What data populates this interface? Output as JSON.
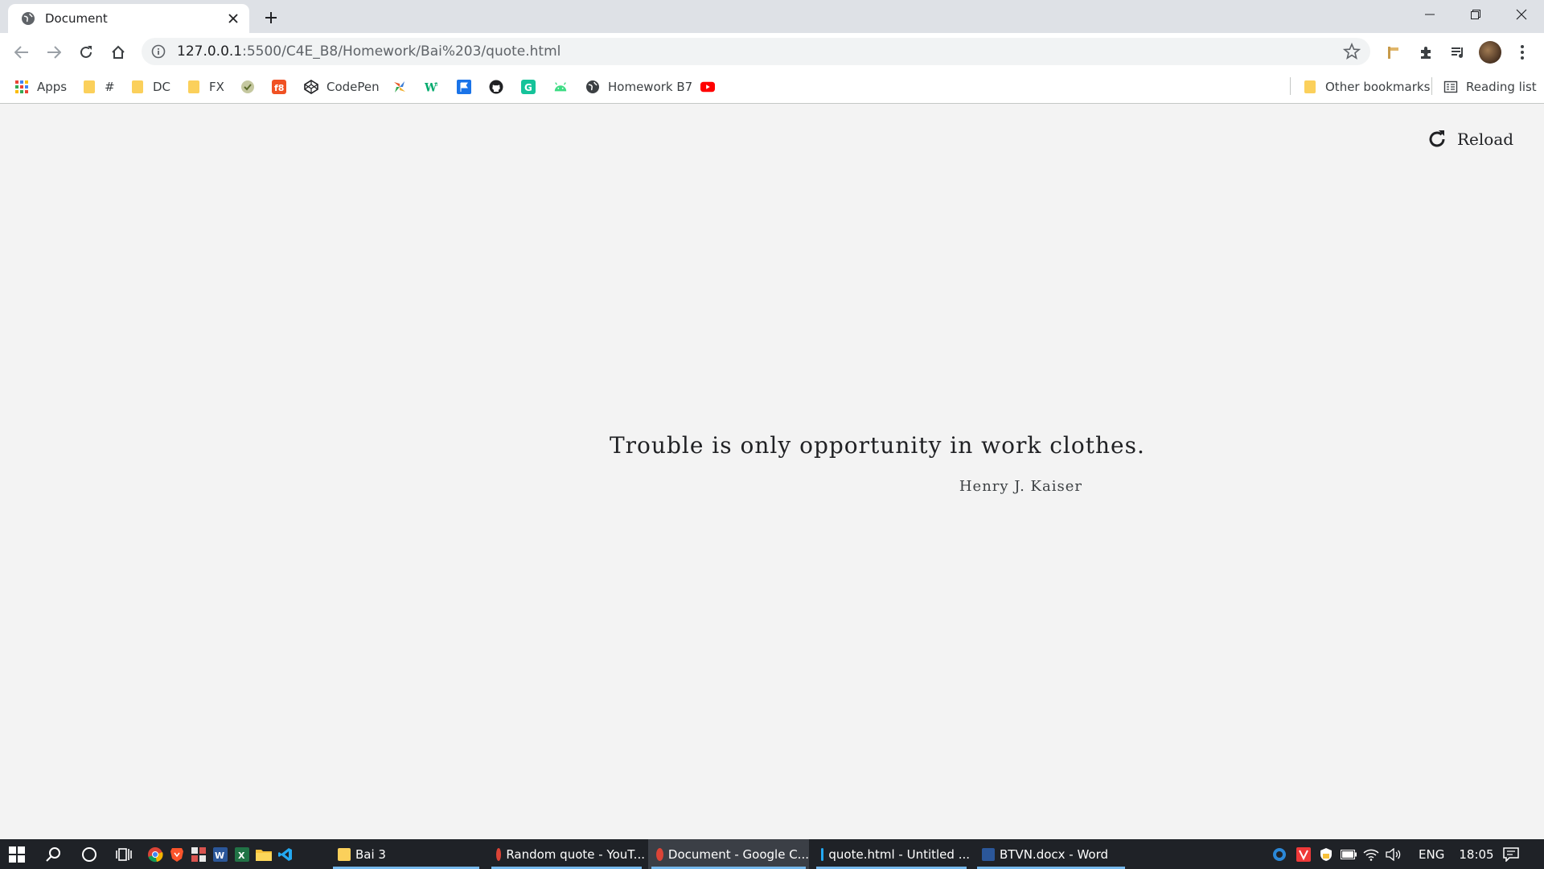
{
  "browser": {
    "tab_title": "Document",
    "url_host": "127.0.0.1",
    "url_path": ":5500/C4E_B8/Homework/Bai%203/quote.html",
    "bookmarks": [
      {
        "label": "Apps",
        "icon": "apps-grid-icon"
      },
      {
        "label": "#",
        "icon": "folder-icon"
      },
      {
        "label": "DC",
        "icon": "folder-icon"
      },
      {
        "label": "FX",
        "icon": "folder-icon"
      },
      {
        "label": "",
        "icon": "checkmark-site-icon"
      },
      {
        "label": "",
        "icon": "f8-icon"
      },
      {
        "label": "CodePen",
        "icon": "codepen-icon"
      },
      {
        "label": "",
        "icon": "pinwheel-icon"
      },
      {
        "label": "",
        "icon": "w3schools-icon"
      },
      {
        "label": "",
        "icon": "flag-icon"
      },
      {
        "label": "",
        "icon": "github-icon"
      },
      {
        "label": "",
        "icon": "grammarly-icon"
      },
      {
        "label": "",
        "icon": "android-icon"
      },
      {
        "label": "Homework B7",
        "icon": "globe-icon"
      },
      {
        "label": "",
        "icon": "youtube-icon"
      }
    ],
    "other_bookmarks": "Other bookmarks",
    "reading_list": "Reading list"
  },
  "page": {
    "reload_label": "Reload",
    "quote": "Trouble is only opportunity in work clothes.",
    "author": "Henry J. Kaiser"
  },
  "taskbar": {
    "apps": [
      {
        "label": "Bai 3",
        "icon": "folder-icon",
        "active": false
      },
      {
        "label": "Random quote - YouT...",
        "icon": "chrome-icon",
        "active": false
      },
      {
        "label": "Document - Google C...",
        "icon": "chrome-icon",
        "active": true
      },
      {
        "label": "quote.html - Untitled ...",
        "icon": "vscode-icon",
        "active": false
      },
      {
        "label": "BTVN.docx - Word",
        "icon": "word-icon",
        "active": false
      }
    ],
    "language": "ENG",
    "time": "18:05"
  },
  "colors": {
    "page_bg": "#f3f3f3",
    "taskbar_bg": "#1f2227",
    "accent": "#76b9ed"
  }
}
